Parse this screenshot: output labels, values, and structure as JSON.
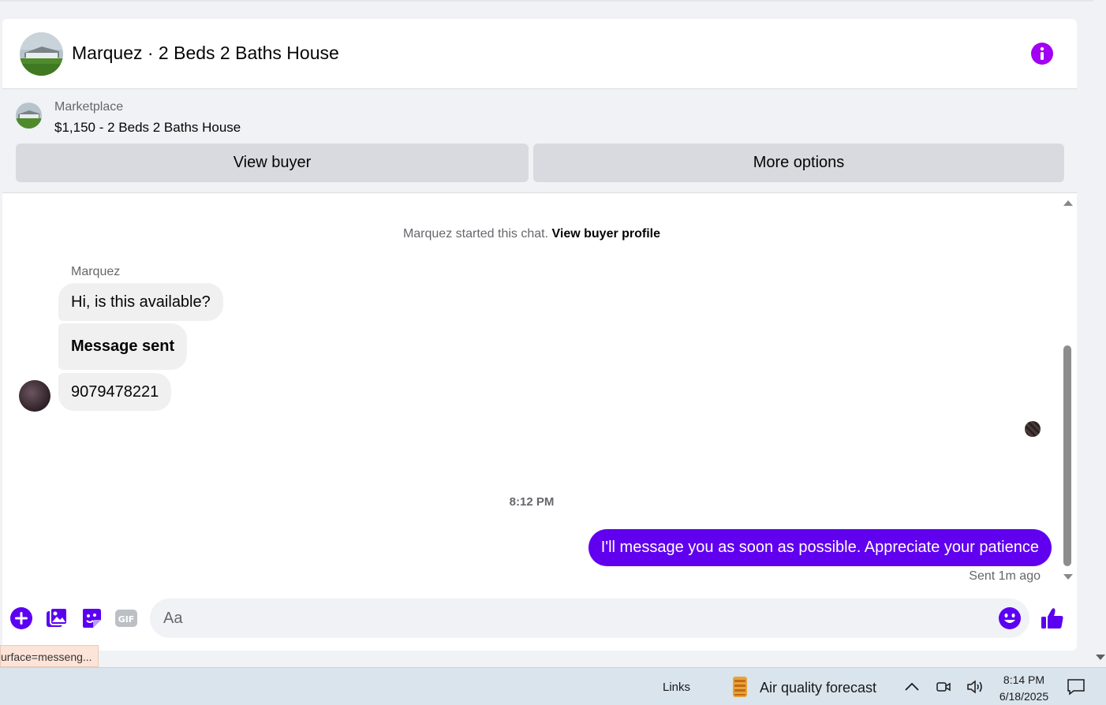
{
  "header": {
    "title": "Marquez · 2 Beds 2 Baths House"
  },
  "listing": {
    "source": "Marketplace",
    "title": "$1,150 - 2 Beds 2 Baths House",
    "view_buyer_label": "View buyer",
    "more_options_label": "More options"
  },
  "messages": {
    "started_text": "Marquez started this chat.",
    "started_link": "View buyer profile",
    "sender_name": "Marquez",
    "incoming": [
      "Hi, is this available?",
      "Message sent",
      "9079478221"
    ],
    "timestamp": "8:12 PM",
    "outgoing": "I'll message you as soon as possible. Appreciate your patience",
    "sent_status": "Sent 1m ago"
  },
  "composer": {
    "placeholder": "Aa",
    "gif_label": "GIF"
  },
  "status_bar": {
    "url_fragment": "urface=messeng..."
  },
  "taskbar": {
    "links_label": "Links",
    "weather_label": "Air quality forecast",
    "time": "8:14 PM",
    "date": "6/18/2025"
  },
  "colors": {
    "accent": "#6000ef",
    "info": "#a100f2",
    "icon": "#5c00f2"
  }
}
